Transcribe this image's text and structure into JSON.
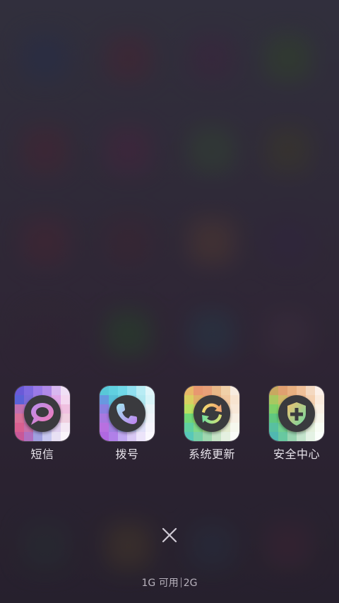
{
  "apps": [
    {
      "label": "短信",
      "icon": "message-bubble-icon",
      "accent": "#c98ef0"
    },
    {
      "label": "拨号",
      "icon": "phone-icon",
      "accent": "#7ad8e8"
    },
    {
      "label": "系统更新",
      "icon": "refresh-arrows-icon",
      "accent": "#e8d070"
    },
    {
      "label": "安全中心",
      "icon": "shield-plus-icon",
      "accent": "#8fd8a0"
    }
  ],
  "close": {
    "icon": "close-icon"
  },
  "memory": {
    "available": "1G 可用",
    "total": "2G"
  }
}
